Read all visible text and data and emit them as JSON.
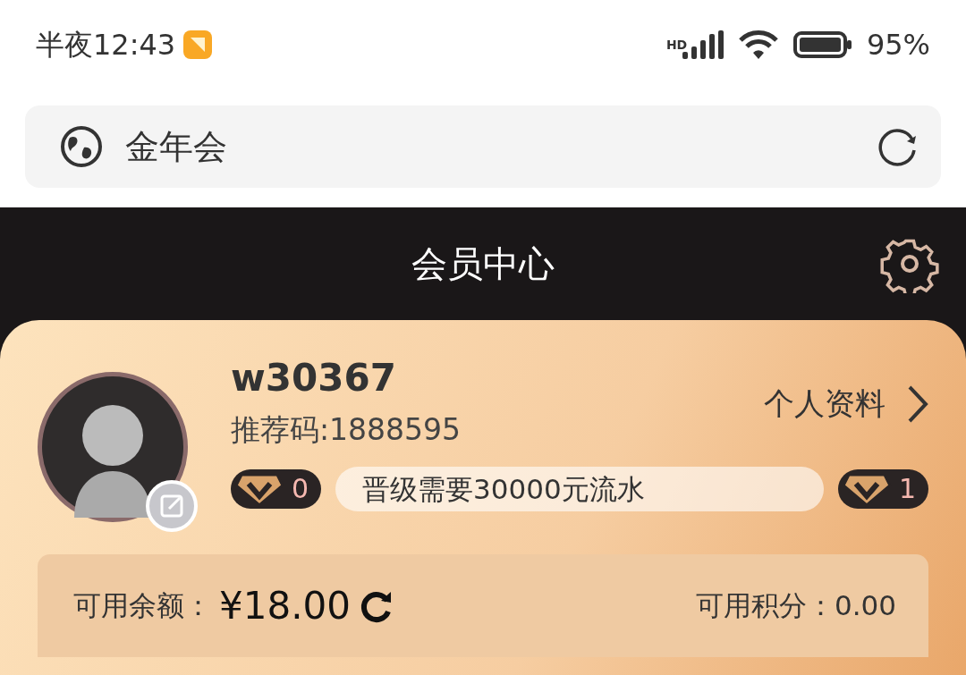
{
  "status_bar": {
    "time": "半夜12:43",
    "network": "HD",
    "battery": "95%"
  },
  "address_bar": {
    "title": "金年会"
  },
  "header": {
    "title": "会员中心"
  },
  "profile": {
    "username": "w30367",
    "referral": "推荐码:1888595",
    "profile_link": "个人资料",
    "level_current": "0",
    "upgrade_hint": "晋级需要30000元流水",
    "level_next": "1"
  },
  "balance": {
    "label": "可用余额：",
    "amount": "¥18.00",
    "points_label": "可用积分：",
    "points": "0.00"
  }
}
